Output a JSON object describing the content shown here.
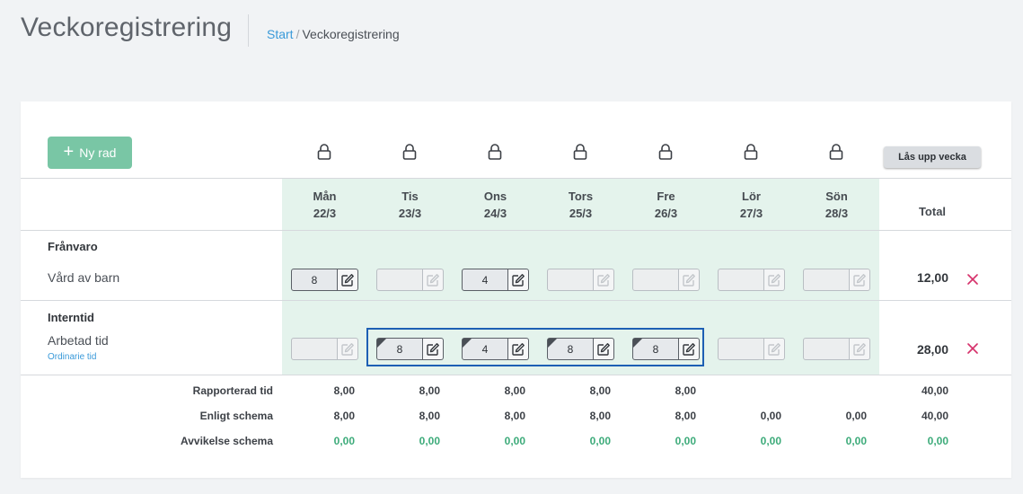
{
  "header": {
    "title": "Veckoregistrering",
    "breadcrumb": {
      "link": "Start",
      "separator": "/",
      "current": "Veckoregistrering"
    }
  },
  "toolbar": {
    "add_row_icon": "+",
    "add_row_label": "Ny rad",
    "unlock_label": "Lås upp vecka"
  },
  "days": [
    {
      "name": "Mån",
      "date": "22/3"
    },
    {
      "name": "Tis",
      "date": "23/3"
    },
    {
      "name": "Ons",
      "date": "24/3"
    },
    {
      "name": "Tors",
      "date": "25/3"
    },
    {
      "name": "Fre",
      "date": "26/3"
    },
    {
      "name": "Lör",
      "date": "27/3"
    },
    {
      "name": "Sön",
      "date": "28/3"
    }
  ],
  "total_header": "Total",
  "sections": [
    {
      "title": "Frånvaro",
      "rows": [
        {
          "label": "Vård av barn",
          "sublabel": "",
          "values": [
            "8",
            "",
            "4",
            "",
            "",
            "",
            ""
          ],
          "total": "12,00"
        }
      ]
    },
    {
      "title": "Interntid",
      "rows": [
        {
          "label": "Arbetad tid",
          "sublabel": "Ordinarie tid",
          "values": [
            "",
            "8",
            "4",
            "8",
            "8",
            "",
            ""
          ],
          "total": "28,00"
        }
      ]
    }
  ],
  "summary": [
    {
      "label": "Rapporterad tid",
      "values": [
        "8,00",
        "8,00",
        "8,00",
        "8,00",
        "8,00",
        "",
        ""
      ],
      "total": "40,00"
    },
    {
      "label": "Enligt schema",
      "values": [
        "8,00",
        "8,00",
        "8,00",
        "8,00",
        "8,00",
        "0,00",
        "0,00"
      ],
      "total": "40,00"
    },
    {
      "label": "Avvikelse schema",
      "values": [
        "0,00",
        "0,00",
        "0,00",
        "0,00",
        "0,00",
        "0,00",
        "0,00"
      ],
      "total": "0,00"
    }
  ],
  "colors": {
    "accent": "#79c6a5",
    "link": "#3a9ad9",
    "deviation": "#3dab7a",
    "delete": "#d6336c",
    "selection": "#1d5fb4"
  },
  "icons": {
    "lock": "lock-icon",
    "edit": "edit-icon",
    "delete": "close-icon",
    "add": "plus-icon"
  }
}
